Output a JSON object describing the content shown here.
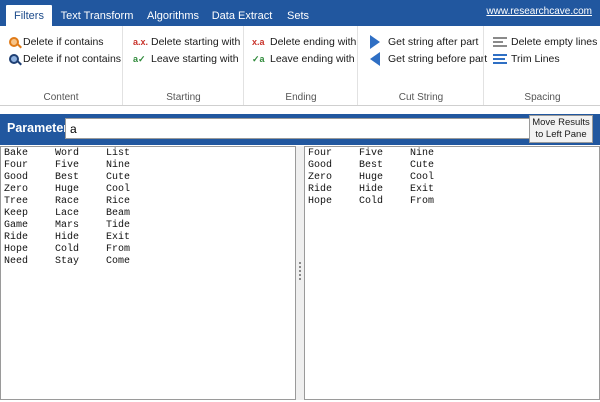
{
  "tabs": [
    {
      "label": "Filters",
      "active": true
    },
    {
      "label": "Text Transform",
      "active": false
    },
    {
      "label": "Algorithms",
      "active": false
    },
    {
      "label": "Data Extract",
      "active": false
    },
    {
      "label": "Sets",
      "active": false
    }
  ],
  "site_link": "www.researchcave.com",
  "ribbon": {
    "content": {
      "label": "Content",
      "buttons": [
        {
          "label": "Delete if contains",
          "icon": "search-orange-icon"
        },
        {
          "label": "Delete if not contains",
          "icon": "search-blue-icon"
        }
      ]
    },
    "starting": {
      "label": "Starting",
      "buttons": [
        {
          "label": "Delete starting with",
          "icon": "ax-icon",
          "glyph": "a.x."
        },
        {
          "label": "Leave starting with",
          "icon": "ax-check-icon",
          "glyph": "a✓"
        }
      ]
    },
    "ending": {
      "label": "Ending",
      "buttons": [
        {
          "label": "Delete ending with",
          "icon": "xa-icon",
          "glyph": "x.a"
        },
        {
          "label": "Leave ending with",
          "icon": "xa-check-icon",
          "glyph": "✓a"
        }
      ]
    },
    "cut_string": {
      "label": "Cut String",
      "buttons": [
        {
          "label": "Get string after part",
          "icon": "arrow-right-icon"
        },
        {
          "label": "Get string before part",
          "icon": "arrow-left-icon"
        }
      ]
    },
    "spacing": {
      "label": "Spacing",
      "buttons": [
        {
          "label": "Delete empty lines",
          "icon": "lines-icon"
        },
        {
          "label": "Trim Lines",
          "icon": "trim-lines-icon"
        }
      ]
    }
  },
  "parameter": {
    "label": "Parameter",
    "value": "a",
    "move_button_line1": "Move Results",
    "move_button_line2": "to Left Pane"
  },
  "left_pane": {
    "rows": [
      [
        "Bake",
        "Word",
        "List"
      ],
      [
        "Four",
        "Five",
        "Nine"
      ],
      [
        "Good",
        "Best",
        "Cute"
      ],
      [
        "Zero",
        "Huge",
        "Cool"
      ],
      [
        "Tree",
        "Race",
        "Rice"
      ],
      [
        "Keep",
        "Lace",
        "Beam"
      ],
      [
        "Game",
        "Mars",
        "Tide"
      ],
      [
        "Ride",
        "Hide",
        "Exit"
      ],
      [
        "Hope",
        "Cold",
        "From"
      ],
      [
        "Need",
        "Stay",
        "Come"
      ]
    ]
  },
  "right_pane": {
    "rows": [
      [
        "Four",
        "Five",
        "Nine"
      ],
      [
        "Good",
        "Best",
        "Cute"
      ],
      [
        "Zero",
        "Huge",
        "Cool"
      ],
      [
        "Ride",
        "Hide",
        "Exit"
      ],
      [
        "Hope",
        "Cold",
        "From"
      ]
    ]
  }
}
